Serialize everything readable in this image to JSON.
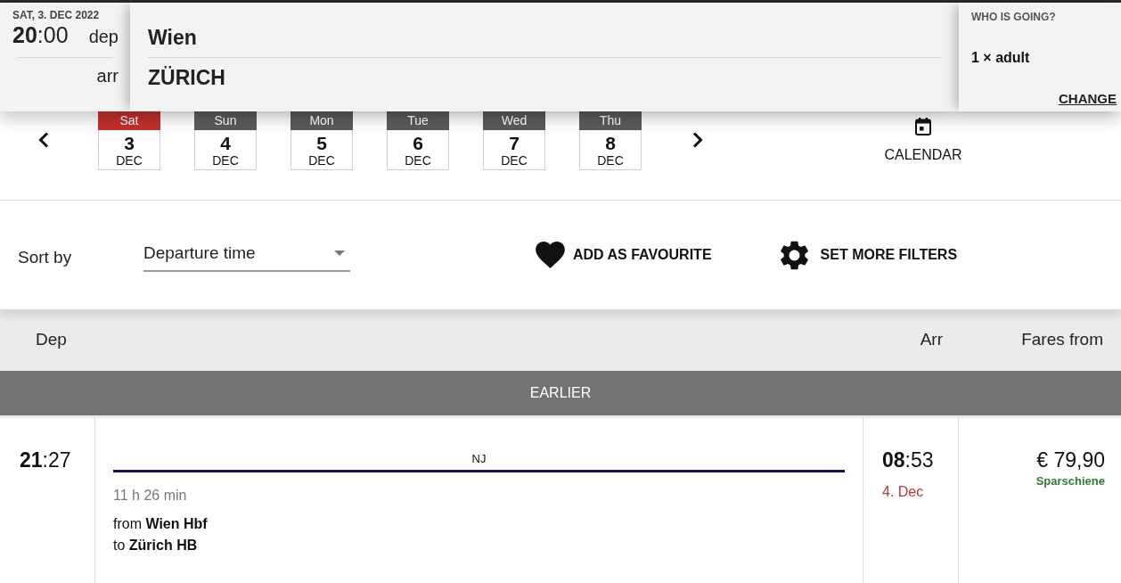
{
  "header": {
    "date": "SAT, 3. DEC 2022",
    "time": "**20**:00",
    "dep_label": "dep",
    "arr_label": "arr",
    "origin": "Wien",
    "destination": "ZÜRICH"
  },
  "passengers": {
    "title": "WHO IS GOING?",
    "summary": "1 × adult",
    "change": "CHANGE"
  },
  "date_strip": {
    "days": [
      {
        "weekday": "Sat",
        "day": "3",
        "month": "DEC",
        "selected": true
      },
      {
        "weekday": "Sun",
        "day": "4",
        "month": "DEC",
        "selected": false
      },
      {
        "weekday": "Mon",
        "day": "5",
        "month": "DEC",
        "selected": false
      },
      {
        "weekday": "Tue",
        "day": "6",
        "month": "DEC",
        "selected": false
      },
      {
        "weekday": "Wed",
        "day": "7",
        "month": "DEC",
        "selected": false
      },
      {
        "weekday": "Thu",
        "day": "8",
        "month": "DEC",
        "selected": false
      }
    ],
    "calendar": "CALENDAR"
  },
  "filters": {
    "sort_label": "Sort by",
    "sort_value": "Departure time",
    "favourite": "ADD AS FAVOURITE",
    "more_filters": "SET MORE FILTERS"
  },
  "table": {
    "columns": [
      "Dep",
      "Arr",
      "Fares from"
    ],
    "earlier": "EARLIER",
    "connections": [
      {
        "departure": "**21**:27",
        "train": "NJ",
        "duration": "11 h 26 min",
        "from": "from **Wien Hbf**",
        "to": "to **Zürich HB**",
        "arrival": "**08**:53",
        "arrival_date": "4. Dec",
        "price": "€ 79,90",
        "fare_name": "Sparschiene"
      }
    ]
  }
}
